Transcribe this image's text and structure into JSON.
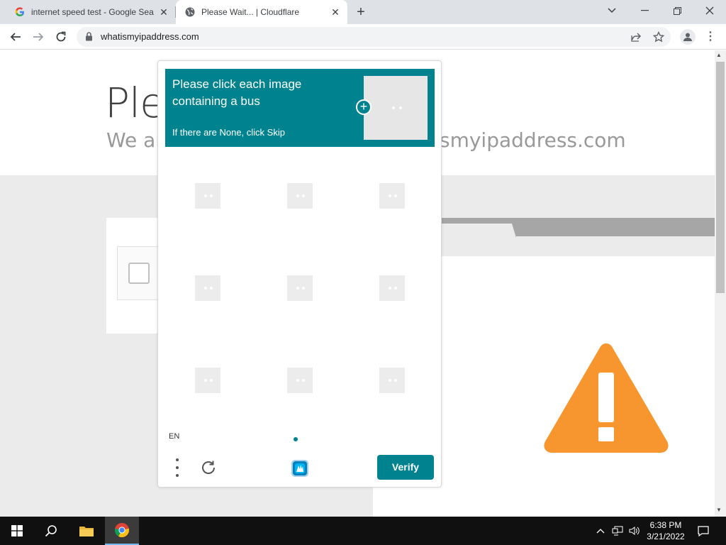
{
  "browser": {
    "tabs": [
      {
        "title": "internet speed test - Google Sea",
        "icon": "google-icon"
      },
      {
        "title": "Please Wait... | Cloudflare",
        "icon": "globe-icon"
      }
    ],
    "url": "whatismyipaddress.com"
  },
  "page": {
    "heading": "Ple",
    "subline_left": "We ar",
    "subline_right": "smyipaddress.com",
    "accent_color": "#f7962e"
  },
  "captcha": {
    "prompt": "Please click each image containing a bus",
    "skip_hint": "If there are None, click Skip",
    "language": "EN",
    "verify_label": "Verify",
    "accent_color": "#00838f",
    "grid_rows": 3,
    "grid_cols": 3
  },
  "taskbar": {
    "time": "6:38 PM",
    "date": "3/21/2022"
  }
}
